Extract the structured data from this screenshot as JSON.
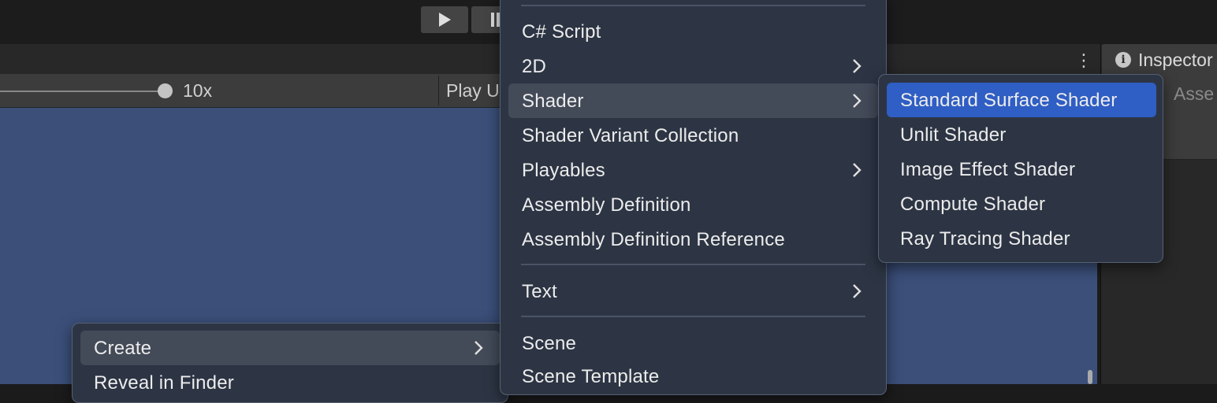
{
  "toolbar": {
    "play_icon": "play-icon",
    "pause_icon": "pause-icon"
  },
  "game_view": {
    "scale_value": "10x",
    "play_unfocused_label": "Play U"
  },
  "inspector": {
    "title": "Inspector",
    "asset_label": "Asse",
    "info_icon": "i",
    "more_icon": "⋮"
  },
  "context_menu": {
    "items": [
      {
        "label": "Create",
        "has_submenu": true
      },
      {
        "label": "Reveal in Finder",
        "has_submenu": false
      }
    ]
  },
  "create_menu": {
    "items": [
      {
        "label": "C# Script",
        "has_submenu": false
      },
      {
        "label": "2D",
        "has_submenu": true
      },
      {
        "label": "Shader",
        "has_submenu": true
      },
      {
        "label": "Shader Variant Collection",
        "has_submenu": false
      },
      {
        "label": "Playables",
        "has_submenu": true
      },
      {
        "label": "Assembly Definition",
        "has_submenu": false
      },
      {
        "label": "Assembly Definition Reference",
        "has_submenu": false
      },
      {
        "label": "Text",
        "has_submenu": true
      },
      {
        "label": "Scene",
        "has_submenu": false
      },
      {
        "label": "Scene Template",
        "has_submenu": false
      }
    ]
  },
  "shader_menu": {
    "items": [
      {
        "label": "Standard Surface Shader"
      },
      {
        "label": "Unlit Shader"
      },
      {
        "label": "Image Effect Shader"
      },
      {
        "label": "Compute Shader"
      },
      {
        "label": "Ray Tracing Shader"
      }
    ]
  },
  "colors": {
    "menu_bg": "#2d3544",
    "highlight": "#2f5ec4",
    "hover": "#434a58",
    "game_view_bg": "#3b4f79"
  }
}
